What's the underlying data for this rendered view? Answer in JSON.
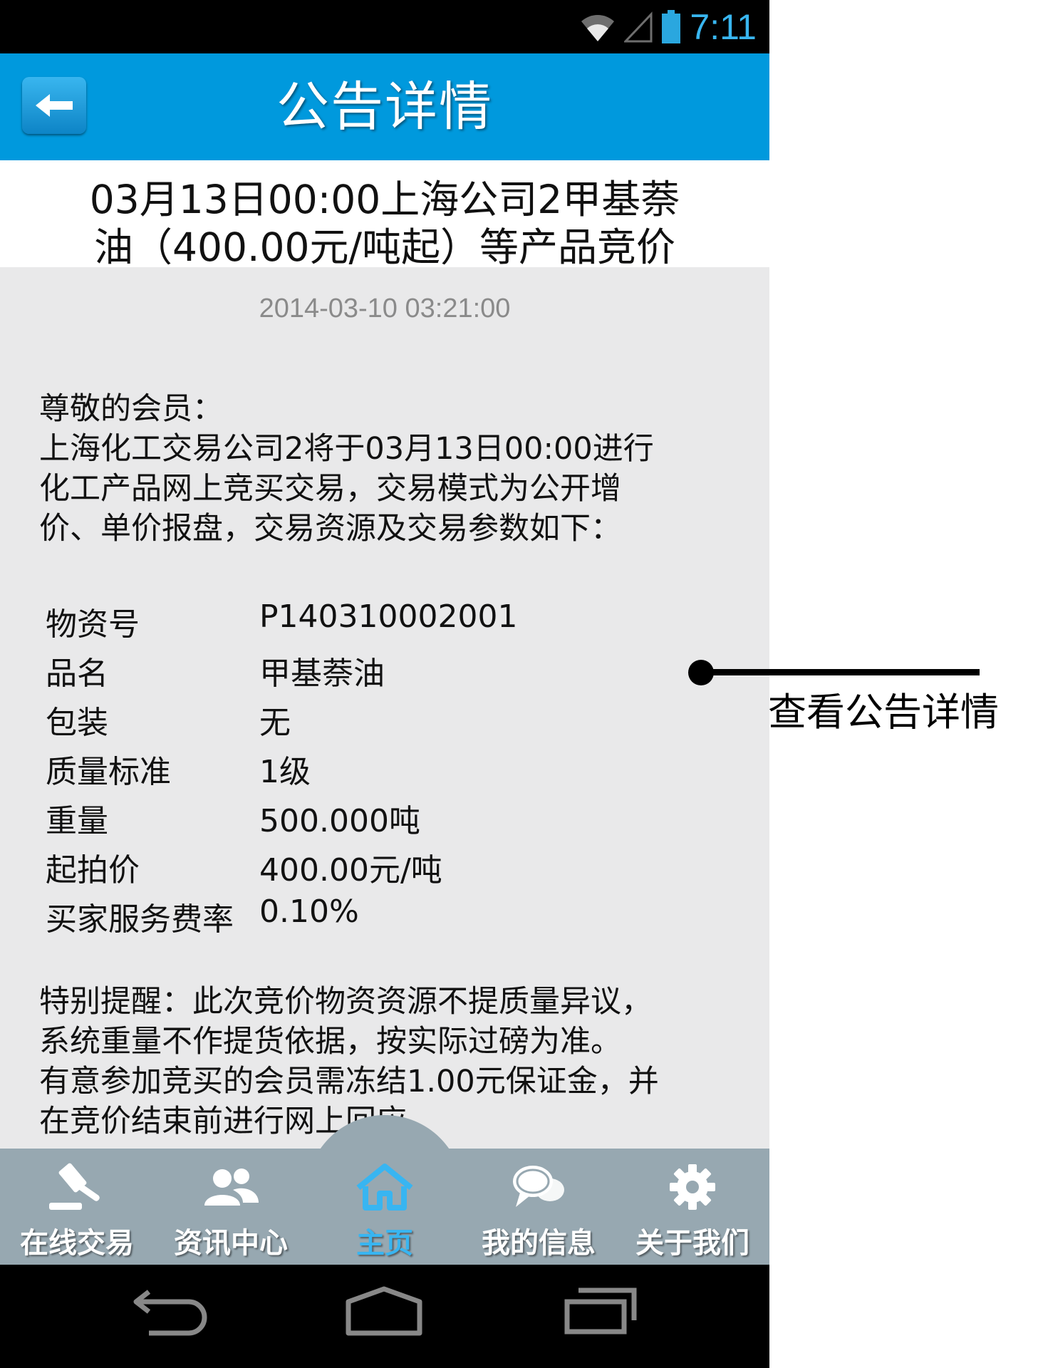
{
  "status_bar": {
    "time": "7:11",
    "icons": [
      "wifi-icon",
      "signal-icon",
      "battery-icon"
    ]
  },
  "header": {
    "title": "公告详情",
    "back_icon": "back-arrow-icon"
  },
  "announcement": {
    "title_line1": "03月13日00:00上海公司2甲基萘",
    "title_line2": "油（400.00元/吨起）等产品竞价",
    "date": "2014-03-10 03:21:00",
    "intro": [
      "尊敬的会员：",
      "上海化工交易公司2将于03月13日00:00进行",
      "化工产品网上竞买交易，交易模式为公开增",
      "价、单价报盘，交易资源及交易参数如下："
    ],
    "specs": [
      {
        "label": "物资号",
        "value": "P140310002001"
      },
      {
        "label": "品名",
        "value": "甲基萘油"
      },
      {
        "label": "包装",
        "value": "无"
      },
      {
        "label": "质量标准",
        "value": "1级"
      },
      {
        "label": "重量",
        "value": "500.000吨"
      },
      {
        "label": "起拍价",
        "value": "400.00元/吨"
      },
      {
        "label": "买家服务费率",
        "value": "0.10%"
      }
    ],
    "notice": [
      "特别提醒：此次竞价物资资源不提质量异议，",
      "系统重量不作提货依据，按实际过磅为准。",
      "有意参加竞买的会员需冻结1.00元保证金，并",
      "在竞价结束前进行网上回应。"
    ]
  },
  "bottom_nav": [
    {
      "label": "在线交易",
      "icon": "gavel-icon",
      "active": false
    },
    {
      "label": "资讯中心",
      "icon": "users-icon",
      "active": false
    },
    {
      "label": "主页",
      "icon": "home-icon",
      "active": true
    },
    {
      "label": "我的信息",
      "icon": "chat-bubbles-icon",
      "active": false
    },
    {
      "label": "关于我们",
      "icon": "gear-icon",
      "active": false
    }
  ],
  "system_nav": [
    "back-icon",
    "home-icon",
    "recent-apps-icon"
  ],
  "annotation": {
    "text": "查看公告详情"
  },
  "colors": {
    "header": "#0099dd",
    "nav_bg": "#97a8b1",
    "active": "#38b5f1",
    "content_bg": "#e9e9ea"
  }
}
